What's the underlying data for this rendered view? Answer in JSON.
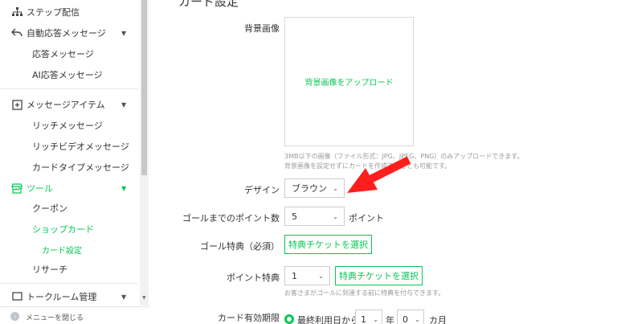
{
  "sidebar": {
    "step_delivery": "ステップ配信",
    "auto_reply": "自動応答メッセージ",
    "reply_message": "応答メッセージ",
    "ai_reply_message": "AI応答メッセージ",
    "message_items": "メッセージアイテム",
    "rich_message": "リッチメッセージ",
    "rich_video_message": "リッチビデオメッセージ",
    "card_type_message": "カードタイプメッセージ",
    "tools": "ツール",
    "coupon": "クーポン",
    "shop_card": "ショップカード",
    "card_settings": "カード設定",
    "research": "リサーチ",
    "talk_room": "トークルーム管理",
    "close_menu": "メニューを閉じる",
    "accent_color": "#06c755"
  },
  "main": {
    "section_title": "カード設定",
    "background_label": "背景画像",
    "upload_text": "背景画像をアップロード",
    "upload_note_1": "3MB以下の画像（ファイル形式：JPG、JPEG、PNG）のみアップロードできます。",
    "upload_note_2": "背景画像を設定せずにカードを作成することも可能です。",
    "design_label": "デザイン",
    "design_value": "ブラウン",
    "goal_points_label": "ゴールまでのポイント数",
    "goal_points_value": "5",
    "points_unit": "ポイント",
    "goal_reward_label": "ゴール特典（必須）",
    "select_ticket": "特典チケットを選択",
    "point_reward_label": "ポイント特典",
    "point_reward_value": "1",
    "point_reward_note": "お客さまがゴールに到達する前に特典を付与できます。",
    "expiry_label": "カード有効期限",
    "expiry_option": "最終利用日から",
    "years_value": "1",
    "years_unit": "年",
    "months_value": "0",
    "months_unit": "カ月"
  }
}
